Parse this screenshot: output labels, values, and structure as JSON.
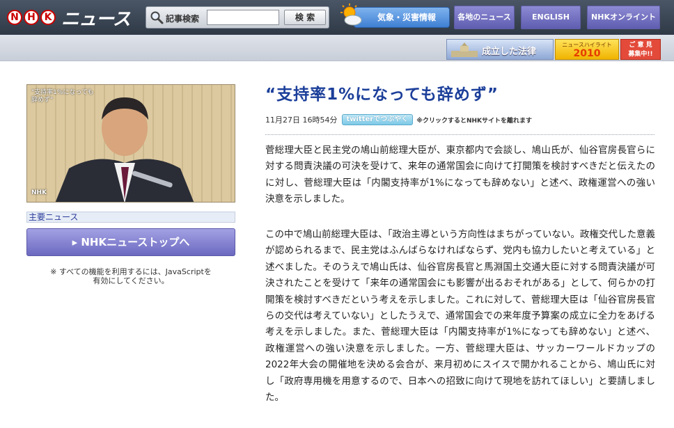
{
  "header": {
    "logo_text": "ニュース",
    "logo_letters": [
      "N",
      "H",
      "K"
    ],
    "search_label": "記事検索",
    "search_value": "",
    "search_button": "検 索",
    "weather_label": "気象・災害情報",
    "nav": [
      "各地のニュース",
      "ENGLISH",
      "NHKオンライントップ"
    ]
  },
  "banners": {
    "law_label": "成立した法律",
    "highlight_top": "ニュースハイライト",
    "highlight_year": "2010",
    "opinion_label": "ご 意 見\n募集中!!"
  },
  "left": {
    "photo_caption": "\"支持率1%になっても\n辞めず\"",
    "photo_bug": "NHK",
    "section_label": "主要ニュース",
    "top_button": "▸ NHKニューストップへ",
    "js_note": "※ すべての機能を利用するには、JavaScriptを\n有効にしてください。"
  },
  "article": {
    "headline": "“支持率1%になっても辞めず”",
    "datetime": "11月27日 16時54分",
    "twitter_button": "twitterでつぶやく",
    "twitter_note": "※クリックするとNHKサイトを離れます",
    "paragraph1": "菅総理大臣と民主党の鳩山前総理大臣が、東京都内で会談し、鳩山氏が、仙谷官房長官らに対する問責決議の可決を受けて、来年の通常国会に向けて打開策を検討すべきだと伝えたのに対し、菅総理大臣は「内閣支持率が1%になっても辞めない」と述べ、政権運営への強い決意を示しました。",
    "paragraph2": "この中で鳩山前総理大臣は、「政治主導という方向性はまちがっていない。政権交代した意義が認められるまで、民主党はふんばらなければならず、党内も協力したいと考えている」と述べました。そのうえで鳩山氏は、仙谷官房長官と馬淵国土交通大臣に対する問責決議が可決されたことを受けて「来年の通常国会にも影響が出るおそれがある」として、何らかの打開策を検討すべきだという考えを示しました。これに対して、菅総理大臣は「仙谷官房長官らの交代は考えていない」としたうえで、通常国会での来年度予算案の成立に全力をあげる考えを示しました。また、菅総理大臣は「内閣支持率が1%になっても辞めない」と述べ、政権運営への強い決意を示しました。一方、菅総理大臣は、サッカーワールドカップの2022年大会の開催地を決める会合が、来月初めにスイスで開かれることから、鳩山氏に対し「政府専用機を用意するので、日本への招致に向けて現地を訪れてほしい」と要請しました。"
  },
  "colors": {
    "headline": "#1c3f9a",
    "nav_button": "#6f6dc2",
    "weather_button": "#4a8ad8"
  }
}
